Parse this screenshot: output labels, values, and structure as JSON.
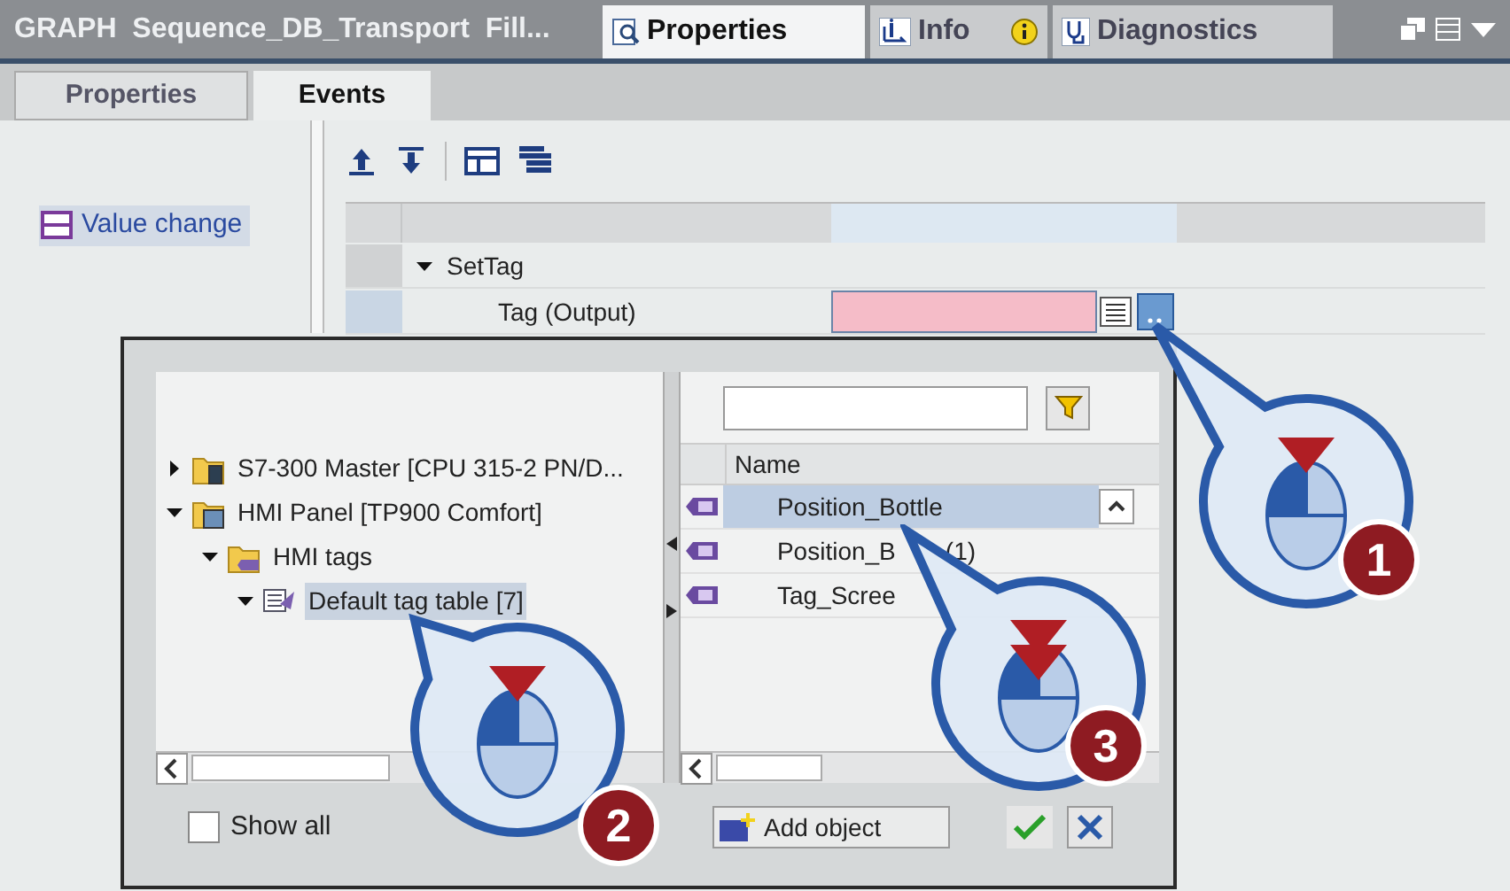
{
  "title_bar": {
    "title": "GRAPH  Sequence_DB_Transport  Fill...",
    "tabs": [
      {
        "label": "Properties",
        "kind": "properties",
        "selected": true
      },
      {
        "label": "Info",
        "kind": "info",
        "selected": false
      },
      {
        "label": "Diagnostics",
        "kind": "diagnostics",
        "selected": false
      }
    ]
  },
  "subtabs": [
    {
      "label": "Properties",
      "selected": false
    },
    {
      "label": "Events",
      "selected": true
    }
  ],
  "events": [
    {
      "label": "Value change",
      "selected": true
    }
  ],
  "grid": {
    "rows": [
      {
        "kind": "function",
        "label": "SetTag",
        "expanded": true
      },
      {
        "kind": "param",
        "label": "Tag (Output)",
        "invalid": true
      }
    ]
  },
  "dialog": {
    "tree": [
      {
        "label": "S7-300 Master [CPU 315-2 PN/D...",
        "kind": "plc",
        "expanded": false,
        "selected": false
      },
      {
        "label": "HMI Panel [TP900 Comfort]",
        "kind": "hmi",
        "expanded": true,
        "selected": false,
        "children": [
          {
            "label": "HMI tags",
            "kind": "folder",
            "expanded": true,
            "selected": false,
            "children": [
              {
                "label": "Default tag table [7]",
                "kind": "table",
                "expanded": true,
                "selected": true
              }
            ]
          }
        ]
      }
    ],
    "show_all": {
      "label": "Show all",
      "checked": false
    },
    "list": {
      "column": "Name",
      "rows": [
        {
          "name": "Position_Bottle",
          "selected": true
        },
        {
          "name": "Position_B",
          "tail": "(1)",
          "selected": false
        },
        {
          "name": "Tag_Scree",
          "selected": false
        }
      ]
    },
    "add_button": "Add object"
  },
  "callouts": [
    {
      "label": "1",
      "kind": "click"
    },
    {
      "label": "2",
      "kind": "click"
    },
    {
      "label": "3",
      "kind": "double_click"
    }
  ]
}
